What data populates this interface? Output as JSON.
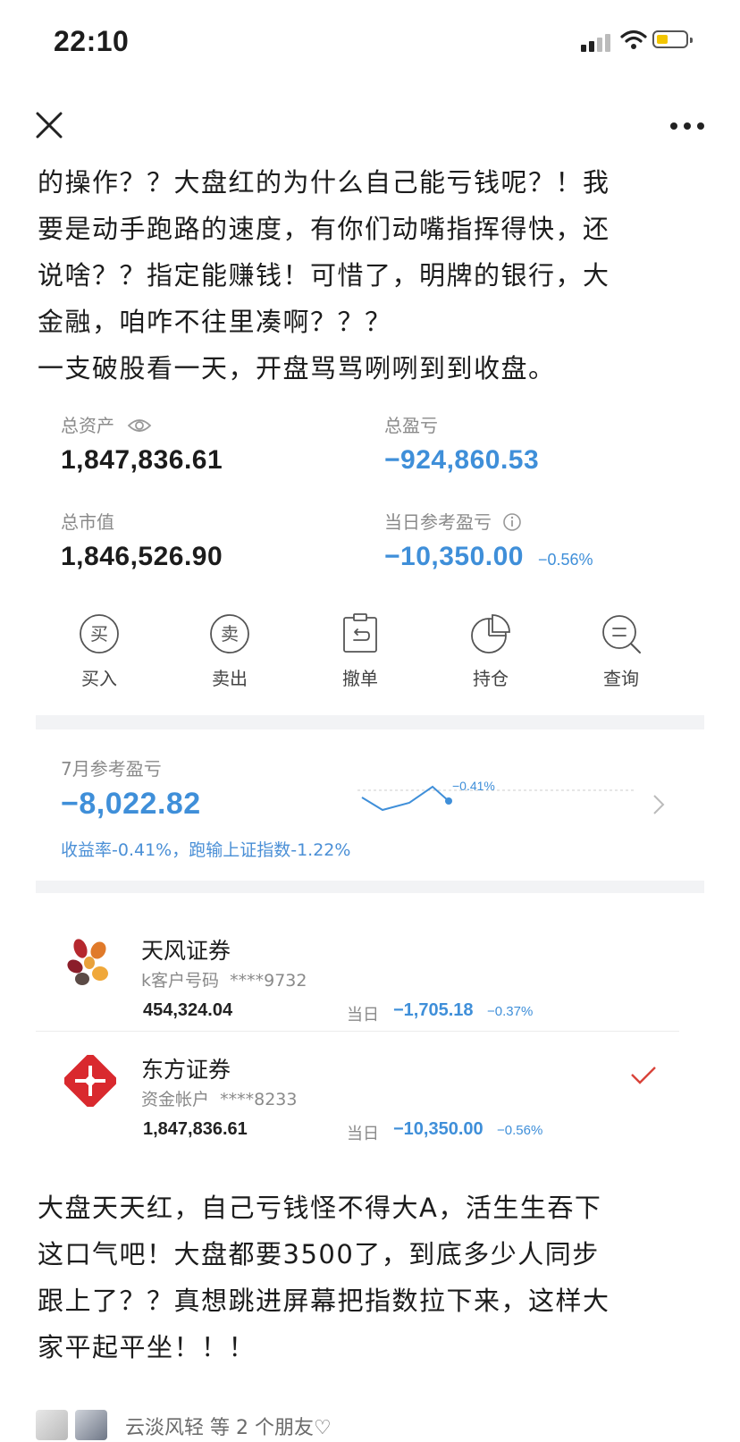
{
  "status_bar": {
    "time": "22:10"
  },
  "post": {
    "text_before": [
      "的操作？？大盘红的为什么自己能亏钱呢？！我",
      "要是动手跑路的速度，有你们动嘴指挥得快，还",
      "说啥？？指定能赚钱！可惜了，明牌的银行，大",
      "金融，咱咋不往里凑啊？？？",
      "一支破股看一天，开盘骂骂咧咧到到收盘。"
    ],
    "text_after": [
      "大盘天天红，自己亏钱怪不得大A，活生生吞下",
      "这口气吧！大盘都要3500了，到底多少人同步",
      "跟上了？？真想跳进屏幕把指数拉下来，这样大",
      "家平起平坐！！！"
    ]
  },
  "assets": {
    "total_assets_label": "总资产",
    "total_assets": "1,847,836.61",
    "total_pnl_label": "总盈亏",
    "total_pnl": "−924,860.53",
    "market_value_label": "总市值",
    "market_value": "1,846,526.90",
    "day_pnl_label": "当日参考盈亏",
    "day_pnl": "−10,350.00",
    "day_pnl_pct": "−0.56%"
  },
  "actions": [
    {
      "label": "买入",
      "icon_char": "买"
    },
    {
      "label": "卖出",
      "icon_char": "卖"
    },
    {
      "label": "撤单"
    },
    {
      "label": "持仓"
    },
    {
      "label": "查询"
    }
  ],
  "monthly": {
    "label": "7月参考盈亏",
    "value": "−8,022.82",
    "spark_label": "−0.41%",
    "summary": "收益率-0.41%，跑输上证指数-1.22%"
  },
  "accounts": [
    {
      "name": "天风证券",
      "id_label": "k客户号码",
      "id": "****9732",
      "assets": "454,324.04",
      "day_label": "当日",
      "day_pnl": "−1,705.18",
      "day_pct": "−0.37%",
      "selected": false
    },
    {
      "name": "东方证券",
      "id_label": "资金帐户",
      "id": "****8233",
      "assets": "1,847,836.61",
      "day_label": "当日",
      "day_pnl": "−10,350.00",
      "day_pct": "−0.56%",
      "selected": true
    }
  ],
  "footer": {
    "likes": "云淡风轻 等 2 个朋友♡"
  },
  "colors": {
    "negative": "#3f8fd9",
    "check": "#d9433a"
  }
}
